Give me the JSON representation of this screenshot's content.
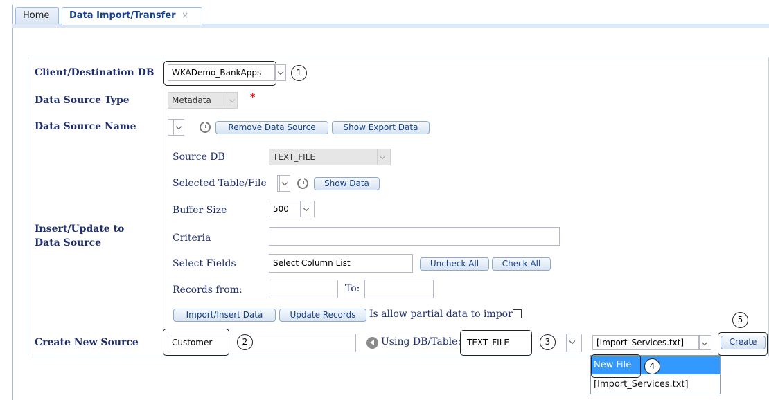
{
  "tabs": [
    {
      "label": "Home"
    },
    {
      "label": "Data Import/Transfer",
      "close": "×"
    }
  ],
  "form": {
    "client_db": {
      "label": "Client/Destination DB",
      "value": "WKADemo_BankApps"
    },
    "source_type": {
      "label": "Data Source Type",
      "value": "Metadata",
      "required_mark": "*"
    },
    "source_name": {
      "label": "Data Source Name",
      "remove_button": "Remove Data Source",
      "show_export_button": "Show Export Data"
    },
    "insert_update": {
      "label_line1": "Insert/Update to",
      "label_line2": "Data Source",
      "source_db_label": "Source DB",
      "source_db_value": "TEXT_FILE",
      "selected_table_label": "Selected Table/File",
      "show_data_button": "Show Data",
      "buffer_label": "Buffer Size",
      "buffer_value": "500",
      "criteria_label": "Criteria",
      "criteria_value": "",
      "select_fields_label": "Select Fields",
      "select_fields_value": "Select Column List",
      "uncheck_all_button": "Uncheck All",
      "check_all_button": "Check All",
      "records_from_label": "Records from:",
      "to_label": "To:",
      "import_insert_button": "Import/Insert Data",
      "update_records_button": "Update Records",
      "partial_label": "Is allow partial data to import?",
      "partial_checked": false
    },
    "create_new": {
      "label": "Create New Source",
      "name_value": "Customer",
      "using_label": "Using DB/Table:",
      "db_value": "TEXT_FILE",
      "file_value": "[Import_Services.txt]",
      "create_button": "Create"
    }
  },
  "file_dropdown": {
    "options": [
      "New File",
      "[Import_Services.txt]"
    ],
    "highlighted": "New File"
  },
  "annotations": [
    "1",
    "2",
    "3",
    "4",
    "5"
  ],
  "colors": {
    "accent": "#15428b",
    "label": "#1f2f6b",
    "selected": "#3399ff",
    "required": "#dd1111"
  }
}
